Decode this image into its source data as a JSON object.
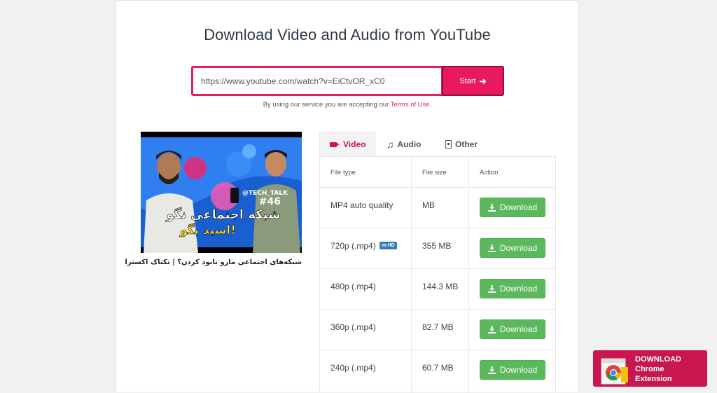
{
  "page": {
    "title": "Download Video and Audio from YouTube"
  },
  "search": {
    "value": "https://www.youtube.com/watch?v=EiCtvOR_xC0",
    "start_label": "Start"
  },
  "terms": {
    "prefix": "By using our service you are accepting our ",
    "link": "Terms of Use",
    "suffix": "."
  },
  "video": {
    "thumbnail_tag": "@TECH_TALK",
    "thumbnail_episode": "#46",
    "thumbnail_caption_line1": "شبکه اجتماعی نگو",
    "thumbnail_caption_line2": "اسید بگو!",
    "title": "شبکه‌های اجتماعی مارو نابود کردن؟ | تکتاک اکسترا"
  },
  "tabs": [
    {
      "label": "Video",
      "icon": "video-camera-icon",
      "active": true
    },
    {
      "label": "Audio",
      "icon": "music-note-icon",
      "active": false
    },
    {
      "label": "Other",
      "icon": "file-icon",
      "active": false
    }
  ],
  "table": {
    "headers": [
      "File type",
      "File size",
      "Action"
    ],
    "rows": [
      {
        "type": "MP4 auto quality",
        "badge": "",
        "size": "MB",
        "action": "Download"
      },
      {
        "type": "720p (.mp4)",
        "badge": "m-HD",
        "size": "355 MB",
        "action": "Download"
      },
      {
        "type": "480p (.mp4)",
        "badge": "",
        "size": "144.3 MB",
        "action": "Download"
      },
      {
        "type": "360p (.mp4)",
        "badge": "",
        "size": "82.7 MB",
        "action": "Download"
      },
      {
        "type": "240p (.mp4)",
        "badge": "",
        "size": "60.7 MB",
        "action": "Download"
      }
    ]
  },
  "chrome_extension": {
    "line1": "DOWNLOAD",
    "line2": "Chrome",
    "line3": "Extension"
  },
  "colors": {
    "accent": "#e8195f",
    "download_green": "#5cb85c",
    "badge_blue": "#337ab7"
  }
}
